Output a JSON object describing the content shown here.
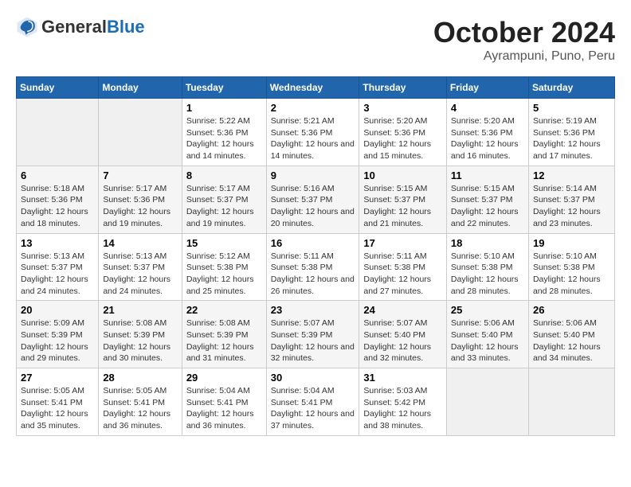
{
  "header": {
    "logo_line1": "General",
    "logo_line2": "Blue",
    "month": "October 2024",
    "location": "Ayrampuni, Puno, Peru"
  },
  "columns": [
    "Sunday",
    "Monday",
    "Tuesday",
    "Wednesday",
    "Thursday",
    "Friday",
    "Saturday"
  ],
  "weeks": [
    [
      {
        "day": "",
        "sunrise": "",
        "sunset": "",
        "daylight": ""
      },
      {
        "day": "",
        "sunrise": "",
        "sunset": "",
        "daylight": ""
      },
      {
        "day": "1",
        "sunrise": "Sunrise: 5:22 AM",
        "sunset": "Sunset: 5:36 PM",
        "daylight": "Daylight: 12 hours and 14 minutes."
      },
      {
        "day": "2",
        "sunrise": "Sunrise: 5:21 AM",
        "sunset": "Sunset: 5:36 PM",
        "daylight": "Daylight: 12 hours and 14 minutes."
      },
      {
        "day": "3",
        "sunrise": "Sunrise: 5:20 AM",
        "sunset": "Sunset: 5:36 PM",
        "daylight": "Daylight: 12 hours and 15 minutes."
      },
      {
        "day": "4",
        "sunrise": "Sunrise: 5:20 AM",
        "sunset": "Sunset: 5:36 PM",
        "daylight": "Daylight: 12 hours and 16 minutes."
      },
      {
        "day": "5",
        "sunrise": "Sunrise: 5:19 AM",
        "sunset": "Sunset: 5:36 PM",
        "daylight": "Daylight: 12 hours and 17 minutes."
      }
    ],
    [
      {
        "day": "6",
        "sunrise": "Sunrise: 5:18 AM",
        "sunset": "Sunset: 5:36 PM",
        "daylight": "Daylight: 12 hours and 18 minutes."
      },
      {
        "day": "7",
        "sunrise": "Sunrise: 5:17 AM",
        "sunset": "Sunset: 5:36 PM",
        "daylight": "Daylight: 12 hours and 19 minutes."
      },
      {
        "day": "8",
        "sunrise": "Sunrise: 5:17 AM",
        "sunset": "Sunset: 5:37 PM",
        "daylight": "Daylight: 12 hours and 19 minutes."
      },
      {
        "day": "9",
        "sunrise": "Sunrise: 5:16 AM",
        "sunset": "Sunset: 5:37 PM",
        "daylight": "Daylight: 12 hours and 20 minutes."
      },
      {
        "day": "10",
        "sunrise": "Sunrise: 5:15 AM",
        "sunset": "Sunset: 5:37 PM",
        "daylight": "Daylight: 12 hours and 21 minutes."
      },
      {
        "day": "11",
        "sunrise": "Sunrise: 5:15 AM",
        "sunset": "Sunset: 5:37 PM",
        "daylight": "Daylight: 12 hours and 22 minutes."
      },
      {
        "day": "12",
        "sunrise": "Sunrise: 5:14 AM",
        "sunset": "Sunset: 5:37 PM",
        "daylight": "Daylight: 12 hours and 23 minutes."
      }
    ],
    [
      {
        "day": "13",
        "sunrise": "Sunrise: 5:13 AM",
        "sunset": "Sunset: 5:37 PM",
        "daylight": "Daylight: 12 hours and 24 minutes."
      },
      {
        "day": "14",
        "sunrise": "Sunrise: 5:13 AM",
        "sunset": "Sunset: 5:37 PM",
        "daylight": "Daylight: 12 hours and 24 minutes."
      },
      {
        "day": "15",
        "sunrise": "Sunrise: 5:12 AM",
        "sunset": "Sunset: 5:38 PM",
        "daylight": "Daylight: 12 hours and 25 minutes."
      },
      {
        "day": "16",
        "sunrise": "Sunrise: 5:11 AM",
        "sunset": "Sunset: 5:38 PM",
        "daylight": "Daylight: 12 hours and 26 minutes."
      },
      {
        "day": "17",
        "sunrise": "Sunrise: 5:11 AM",
        "sunset": "Sunset: 5:38 PM",
        "daylight": "Daylight: 12 hours and 27 minutes."
      },
      {
        "day": "18",
        "sunrise": "Sunrise: 5:10 AM",
        "sunset": "Sunset: 5:38 PM",
        "daylight": "Daylight: 12 hours and 28 minutes."
      },
      {
        "day": "19",
        "sunrise": "Sunrise: 5:10 AM",
        "sunset": "Sunset: 5:38 PM",
        "daylight": "Daylight: 12 hours and 28 minutes."
      }
    ],
    [
      {
        "day": "20",
        "sunrise": "Sunrise: 5:09 AM",
        "sunset": "Sunset: 5:39 PM",
        "daylight": "Daylight: 12 hours and 29 minutes."
      },
      {
        "day": "21",
        "sunrise": "Sunrise: 5:08 AM",
        "sunset": "Sunset: 5:39 PM",
        "daylight": "Daylight: 12 hours and 30 minutes."
      },
      {
        "day": "22",
        "sunrise": "Sunrise: 5:08 AM",
        "sunset": "Sunset: 5:39 PM",
        "daylight": "Daylight: 12 hours and 31 minutes."
      },
      {
        "day": "23",
        "sunrise": "Sunrise: 5:07 AM",
        "sunset": "Sunset: 5:39 PM",
        "daylight": "Daylight: 12 hours and 32 minutes."
      },
      {
        "day": "24",
        "sunrise": "Sunrise: 5:07 AM",
        "sunset": "Sunset: 5:40 PM",
        "daylight": "Daylight: 12 hours and 32 minutes."
      },
      {
        "day": "25",
        "sunrise": "Sunrise: 5:06 AM",
        "sunset": "Sunset: 5:40 PM",
        "daylight": "Daylight: 12 hours and 33 minutes."
      },
      {
        "day": "26",
        "sunrise": "Sunrise: 5:06 AM",
        "sunset": "Sunset: 5:40 PM",
        "daylight": "Daylight: 12 hours and 34 minutes."
      }
    ],
    [
      {
        "day": "27",
        "sunrise": "Sunrise: 5:05 AM",
        "sunset": "Sunset: 5:41 PM",
        "daylight": "Daylight: 12 hours and 35 minutes."
      },
      {
        "day": "28",
        "sunrise": "Sunrise: 5:05 AM",
        "sunset": "Sunset: 5:41 PM",
        "daylight": "Daylight: 12 hours and 36 minutes."
      },
      {
        "day": "29",
        "sunrise": "Sunrise: 5:04 AM",
        "sunset": "Sunset: 5:41 PM",
        "daylight": "Daylight: 12 hours and 36 minutes."
      },
      {
        "day": "30",
        "sunrise": "Sunrise: 5:04 AM",
        "sunset": "Sunset: 5:41 PM",
        "daylight": "Daylight: 12 hours and 37 minutes."
      },
      {
        "day": "31",
        "sunrise": "Sunrise: 5:03 AM",
        "sunset": "Sunset: 5:42 PM",
        "daylight": "Daylight: 12 hours and 38 minutes."
      },
      {
        "day": "",
        "sunrise": "",
        "sunset": "",
        "daylight": ""
      },
      {
        "day": "",
        "sunrise": "",
        "sunset": "",
        "daylight": ""
      }
    ]
  ]
}
